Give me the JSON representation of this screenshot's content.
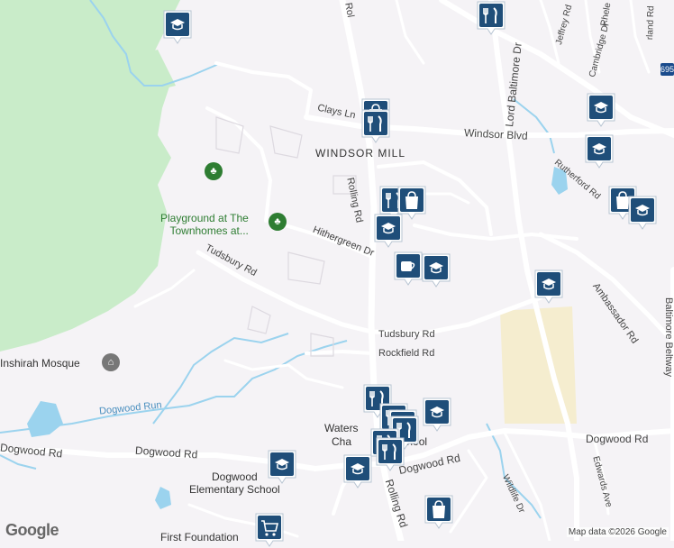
{
  "map": {
    "area_name": "WINDSOR MILL",
    "roads": {
      "clays_ln": "Clays Ln",
      "windsor_blvd": "Windsor Blvd",
      "rolling_rd_north": "Rolling Rd",
      "rolling_rd_south": "Rolling Rd",
      "hithergreen_dr": "Hithergreen Dr",
      "tudsbury_rd_west": "Tudsbury Rd",
      "tudsbury_rd_east": "Tudsbury Rd",
      "rockfield_rd": "Rockfield Rd",
      "dogwood_run": "Dogwood Run",
      "dogwood_rd_west": "Dogwood Rd",
      "dogwood_rd_mid": "Dogwood Rd",
      "dogwood_rd_center": "Dogwood Rd",
      "dogwood_rd_east": "Dogwood Rd",
      "lord_baltimore_dr": "Lord Baltimore Dr",
      "ambassador_rd": "Ambassador Rd",
      "baltimore_beltway": "Baltimore Beltway",
      "rutherford_rd": "Rutherford Rd",
      "jeffrey_rd": "Jeffrey Rd",
      "cambridge_dr": "Cambridge Dr",
      "edwards_ave": "Edwards Ave",
      "wildlife_dr": "Wildlife Dr",
      "rhele": "Rhele",
      "rola": "Rol",
      "rd_top_right": "rland Rd",
      "highway_shield": "695"
    },
    "places": {
      "playground": [
        "Playground at The",
        "Townhomes at..."
      ],
      "mosque": "Inshirah Mosque",
      "dogwood_school": [
        "Dogwood",
        "Elementary School"
      ],
      "waters_school": [
        "Waters",
        "Cha",
        "School"
      ],
      "first_foundation": "First Foundation"
    },
    "colors": {
      "park": "#c9ecc9",
      "road": "#ffffff",
      "water": "#9bd3ee",
      "school_area": "#f5edcf",
      "marker_blue": "#1f4e79"
    },
    "markers": [
      {
        "type": "school"
      },
      {
        "type": "restaurant"
      },
      {
        "type": "shopping"
      },
      {
        "type": "restaurant"
      },
      {
        "type": "school"
      },
      {
        "type": "school"
      },
      {
        "type": "restaurant"
      },
      {
        "type": "shopping"
      },
      {
        "type": "school"
      },
      {
        "type": "shopping"
      },
      {
        "type": "school"
      },
      {
        "type": "cafe"
      },
      {
        "type": "school"
      },
      {
        "type": "school"
      },
      {
        "type": "restaurant"
      },
      {
        "type": "restaurant"
      },
      {
        "type": "restaurant"
      },
      {
        "type": "restaurant"
      },
      {
        "type": "restaurant"
      },
      {
        "type": "restaurant"
      },
      {
        "type": "school"
      },
      {
        "type": "school"
      },
      {
        "type": "school"
      },
      {
        "type": "shopping"
      },
      {
        "type": "grocery"
      }
    ],
    "google_logo": "Google",
    "attribution": "Map data ©2026 Google"
  }
}
